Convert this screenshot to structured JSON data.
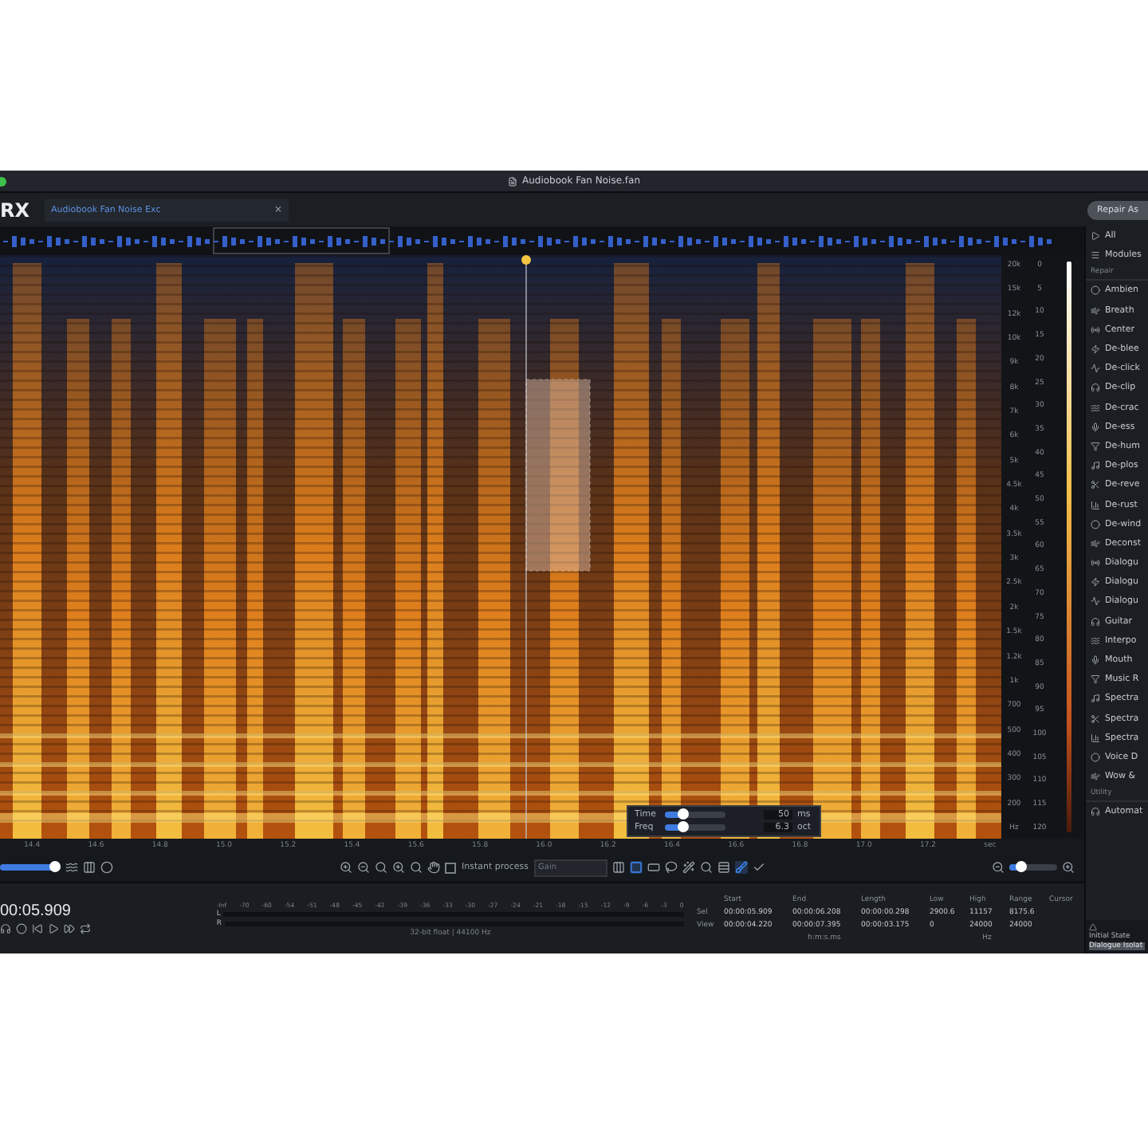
{
  "window": {
    "title": "Audiobook Fan Noise.fan"
  },
  "app": {
    "logo": "RX"
  },
  "tab": {
    "label": "Audiobook Fan Noise Exc",
    "close": "×"
  },
  "repair_button": "Repair As",
  "spectrogram": {
    "freq_labels": [
      "20k",
      "15k",
      "12k",
      "10k",
      "9k",
      "8k",
      "7k",
      "6k",
      "5k",
      "4.5k",
      "4k",
      "3.5k",
      "3k",
      "2.5k",
      "2k",
      "1.5k",
      "1.2k",
      "1k",
      "700",
      "500",
      "400",
      "300",
      "200",
      "Hz"
    ],
    "db_labels": [
      "0",
      "5",
      "10",
      "15",
      "20",
      "25",
      "30",
      "35",
      "40",
      "45",
      "50",
      "55",
      "60",
      "65",
      "70",
      "75",
      "80",
      "85",
      "90",
      "95",
      "100",
      "105",
      "110",
      "115",
      "120"
    ],
    "time_labels": [
      "14.4",
      "14.6",
      "14.8",
      "15.0",
      "15.2",
      "15.4",
      "15.6",
      "15.8",
      "16.0",
      "16.2",
      "16.4",
      "16.6",
      "16.8",
      "17.0",
      "17.2"
    ],
    "time_unit": "sec"
  },
  "resolution_popup": {
    "rows": [
      {
        "label": "Time",
        "level": 0.3,
        "value": "50",
        "unit": "ms"
      },
      {
        "label": "Freq",
        "level": 0.3,
        "value": "6.3",
        "unit": "oct"
      }
    ]
  },
  "toolbar": {
    "zoom_slider": {
      "level": 0.92
    },
    "instant_process": {
      "label": "Instant process",
      "checked": false
    },
    "gain": {
      "value": "Gain"
    },
    "tools": [
      {
        "kind": "time",
        "selected": false
      },
      {
        "kind": "rect",
        "selected": true
      },
      {
        "kind": "freq",
        "selected": false
      },
      {
        "kind": "lasso",
        "selected": false
      },
      {
        "kind": "wand",
        "selected": false
      },
      {
        "kind": "harmonic",
        "selected": false
      },
      {
        "kind": "levels",
        "selected": false
      },
      {
        "kind": "brush",
        "selected": true
      },
      {
        "kind": "check",
        "selected": false
      }
    ],
    "view_zoom_slider": {
      "level": 0.25
    }
  },
  "transport": {
    "timecode": "00:05.909"
  },
  "meter": {
    "scale": [
      "-Inf",
      "-70",
      "-60",
      "-54",
      "-51",
      "-48",
      "-45",
      "-42",
      "-39",
      "-36",
      "-33",
      "-30",
      "-27",
      "-24",
      "-21",
      "-18",
      "-15",
      "-12",
      "-9",
      "-6",
      "-3",
      "0"
    ],
    "channels": [
      "L",
      "R"
    ],
    "format": "32-bit float | 44100 Hz"
  },
  "selection": {
    "columns": [
      "Start",
      "End",
      "Length",
      "Low",
      "High",
      "Range",
      "Cursor"
    ],
    "rows": [
      {
        "label": "Sel",
        "cells": [
          "00:00:05.909",
          "00:00:06.208",
          "00:00:00.298",
          "2900.6",
          "11157",
          "8175.6"
        ]
      },
      {
        "label": "View",
        "cells": [
          "00:00:04.220",
          "00:00:07.395",
          "00:00:03.175",
          "0",
          "24000",
          "24000"
        ]
      }
    ],
    "time_unit": "h:m:s.ms",
    "freq_unit": "Hz"
  },
  "modules": {
    "filter": "All",
    "header": "Modules",
    "sections": [
      {
        "title": "Repair",
        "items": [
          "Ambien",
          "Breath",
          "Center",
          "De-blee",
          "De-click",
          "De-clip",
          "De-crac",
          "De-ess",
          "De-hum",
          "De-plos",
          "De-reve",
          "De-rust",
          "De-wind",
          "Deconst",
          "Dialogu",
          "Dialogu",
          "Dialogu",
          "Guitar",
          "Interpo",
          "Mouth",
          "Music R",
          "Spectra",
          "Spectra",
          "Spectra",
          "Voice D",
          "Wow &"
        ]
      },
      {
        "title": "Utility",
        "items": [
          "Automat"
        ]
      }
    ]
  },
  "state_panel": {
    "label": "Initial State",
    "value": "Dialogue Isolat"
  }
}
